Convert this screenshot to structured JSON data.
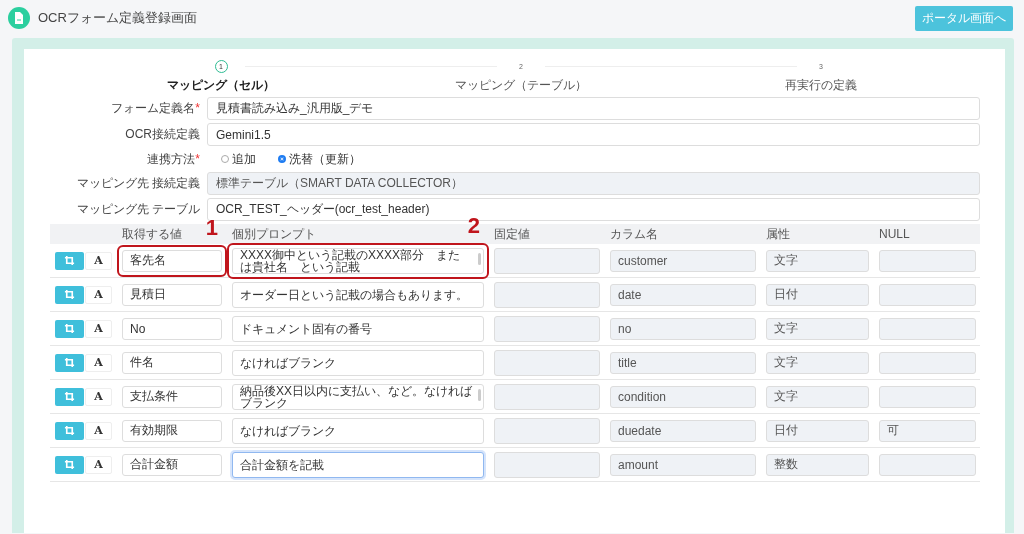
{
  "header": {
    "title": "OCRフォーム定義登録画面",
    "portal_button": "ポータル画面へ"
  },
  "steps": [
    {
      "number": "1",
      "label": "マッピング（セル）",
      "selected": true
    },
    {
      "number": "2",
      "label": "マッピング（テーブル）",
      "selected": false
    },
    {
      "number": "3",
      "label": "再実行の定義",
      "selected": false
    }
  ],
  "form": [
    {
      "kind": "text",
      "label": "フォーム定義名",
      "required_mark": "*",
      "value": "見積書読み込み_汎用版_デモ",
      "disabled": false
    },
    {
      "kind": "text",
      "label": "OCR接続定義",
      "value": "Gemini1.5",
      "disabled": false
    },
    {
      "kind": "radio",
      "label": "連携方法",
      "required_mark": "*",
      "options": [
        {
          "label": "追加",
          "selected": false
        },
        {
          "label": "洗替（更新）",
          "selected": true
        }
      ]
    },
    {
      "kind": "text",
      "label": "マッピング先 接続定義",
      "value": "標準テーブル（SMART DATA COLLECTOR）",
      "disabled": true
    },
    {
      "kind": "text",
      "label": "マッピング先 テーブル",
      "value": "OCR_TEST_ヘッダー(ocr_test_header)",
      "disabled": false
    }
  ],
  "table": {
    "columns": [
      "取得する値",
      "個別プロンプト",
      "固定値",
      "カラム名",
      "属性",
      "NULL"
    ],
    "rows": [
      {
        "font_button": "A",
        "value": "客先名",
        "value_callout": "1",
        "prompt": "XXXX御中という記載のXXXX部分　または貴社名　という記載",
        "prompt_callout": "2",
        "prompt_focused": false,
        "prompt_scroll": true,
        "column": "customer",
        "type": "文字"
      },
      {
        "font_button": "A",
        "value": "見積日",
        "prompt": "オーダー日という記載の場合もあります。",
        "prompt_focused": false,
        "prompt_scroll": false,
        "column": "date",
        "type": "日付"
      },
      {
        "font_button": "A",
        "value": "No",
        "prompt": "ドキュメント固有の番号",
        "prompt_focused": false,
        "prompt_scroll": false,
        "column": "no",
        "type": "文字"
      },
      {
        "font_button": "A",
        "value": "件名",
        "prompt": "なければブランク",
        "prompt_focused": false,
        "prompt_scroll": false,
        "column": "title",
        "type": "文字"
      },
      {
        "font_button": "A",
        "value": "支払条件",
        "prompt": "納品後XX日以内に支払い、など。なければブランク",
        "prompt_focused": false,
        "prompt_scroll": true,
        "column": "condition",
        "type": "文字"
      },
      {
        "font_button": "A",
        "value": "有効期限",
        "prompt": "なければブランク",
        "prompt_focused": false,
        "prompt_scroll": false,
        "column": "duedate",
        "type": "日付",
        "null": "可"
      },
      {
        "font_button": "A",
        "value": "合計金額",
        "prompt": "合計金額を記載",
        "prompt_focused": true,
        "prompt_scroll": false,
        "column": "amount",
        "type": "整数"
      }
    ]
  }
}
